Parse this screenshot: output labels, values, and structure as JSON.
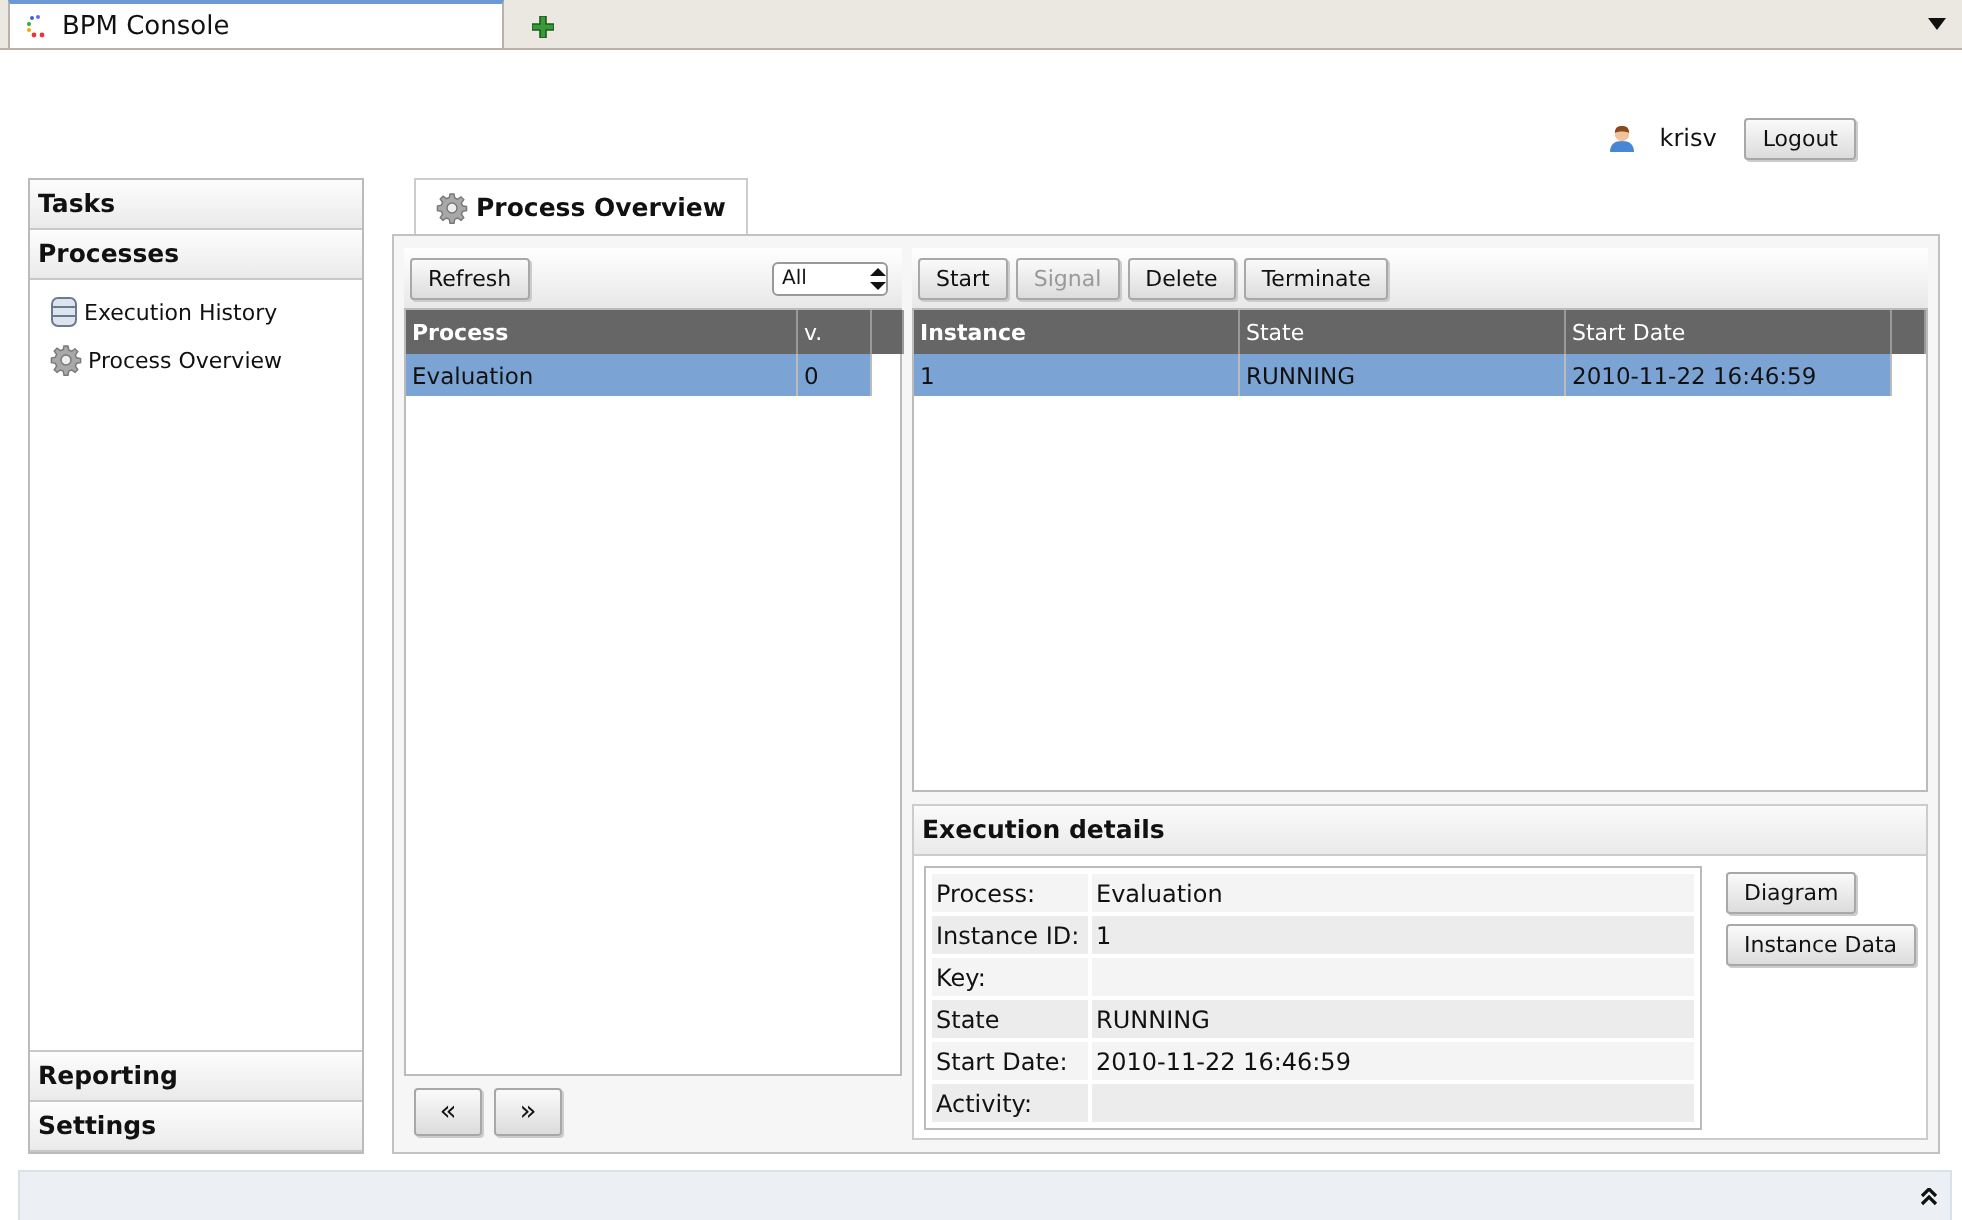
{
  "browser_tab": {
    "title": "BPM Console"
  },
  "user": {
    "name": "krisv"
  },
  "logout_button": "Logout",
  "sidebar": {
    "sections": [
      {
        "title": "Tasks"
      },
      {
        "title": "Processes",
        "items": [
          {
            "label": "Execution History",
            "kind": "history"
          },
          {
            "label": "Process Overview",
            "kind": "overview"
          }
        ]
      },
      {
        "title": "Reporting"
      },
      {
        "title": "Settings"
      }
    ]
  },
  "main_tabs": [
    {
      "label": "Process Overview",
      "selected": true
    }
  ],
  "process_list": {
    "refresh_button": "Refresh",
    "filter": "All",
    "columns": [
      "Process",
      "v."
    ],
    "rows": [
      {
        "cells": [
          "Evaluation",
          "0"
        ],
        "selected": true
      }
    ],
    "pager": [
      "«",
      "»"
    ]
  },
  "instances": {
    "buttons": [
      {
        "label": "Start",
        "disabled": false
      },
      {
        "label": "Signal",
        "disabled": true
      },
      {
        "label": "Delete",
        "disabled": false
      },
      {
        "label": "Terminate",
        "disabled": false
      }
    ],
    "columns": [
      "Instance",
      "State",
      "Start Date"
    ],
    "rows": [
      {
        "cells": [
          "1",
          "RUNNING",
          "2010-11-22 16:46:59"
        ],
        "selected": true
      }
    ]
  },
  "execution_details": {
    "title": "Execution details",
    "fields": [
      {
        "label": "Process:",
        "value": "Evaluation"
      },
      {
        "label": "Instance ID:",
        "value": "1"
      },
      {
        "label": "Key:"
      },
      {
        "label": "State",
        "value": "RUNNING"
      },
      {
        "label": "Start Date:",
        "value": "2010-11-22 16:46:59"
      },
      {
        "label": "Activity:"
      }
    ],
    "buttons": [
      "Diagram",
      "Instance Data"
    ]
  }
}
